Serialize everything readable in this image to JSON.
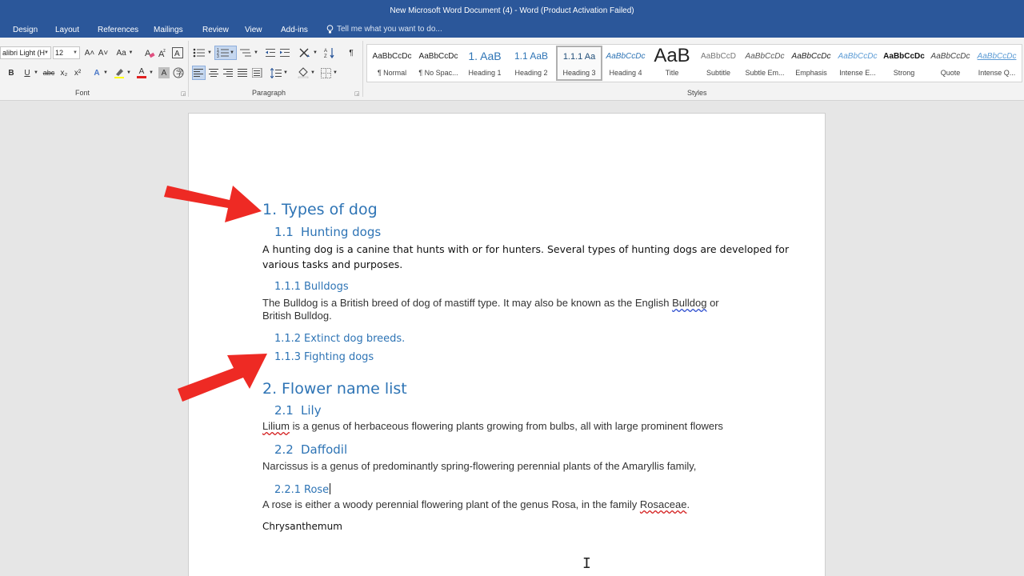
{
  "window": {
    "title": "New Microsoft Word Document (4) - Word (Product Activation Failed)"
  },
  "tabs": [
    "Design",
    "Layout",
    "References",
    "Mailings",
    "Review",
    "View",
    "Add-ins"
  ],
  "tell_me": {
    "placeholder": "Tell me what you want to do..."
  },
  "font_group": {
    "label": "Font",
    "font_name": "alibri Light (H",
    "font_size": "12",
    "case_label": "Aa",
    "bold": "B",
    "italic": "I",
    "underline": "U",
    "strike": "abc",
    "sub": "x₂",
    "sup": "x²",
    "grow": "A˄",
    "shrink": "A˅",
    "font_color": "A",
    "text_effect": "A",
    "char_shade": "A"
  },
  "paragraph_group": {
    "label": "Paragraph",
    "pilcrow": "¶"
  },
  "styles_group": {
    "label": "Styles",
    "items": [
      {
        "preview": "AaBbCcDc",
        "name": "¶ Normal"
      },
      {
        "preview": "AaBbCcDc",
        "name": "¶ No Spac..."
      },
      {
        "preview": "1. AaB",
        "name": "Heading 1"
      },
      {
        "preview": "1.1 AaB",
        "name": "Heading 2"
      },
      {
        "preview": "1.1.1 Aa",
        "name": "Heading 3"
      },
      {
        "preview": "AaBbCcDc",
        "name": "Heading 4"
      },
      {
        "preview": "AaB",
        "name": "Title"
      },
      {
        "preview": "AaBbCcD",
        "name": "Subtitle"
      },
      {
        "preview": "AaBbCcDc",
        "name": "Subtle Em..."
      },
      {
        "preview": "AaBbCcDc",
        "name": "Emphasis"
      },
      {
        "preview": "AaBbCcDc",
        "name": "Intense E..."
      },
      {
        "preview": "AaBbCcDc",
        "name": "Strong"
      },
      {
        "preview": "AaBbCcDc",
        "name": "Quote"
      },
      {
        "preview": "AaBbCcDc",
        "name": "Intense Q..."
      }
    ]
  },
  "document": {
    "h1_1": {
      "num": "1.",
      "text": "Types of dog"
    },
    "h2_1": {
      "num": "1.1",
      "text": "Hunting dogs"
    },
    "p1_line1": "A hunting dog is a canine that hunts with or for hunters. Several types of hunting dogs are developed for",
    "p1_line2": "various tasks and purposes.",
    "h3_1": {
      "num": "1.1.1",
      "text": "Bulldogs"
    },
    "p2_line1_a": "The Bulldog is a British breed of dog of mastiff type. It may also be known as the English ",
    "p2_line1_b": "Bulldog",
    "p2_line1_c": " or",
    "p2_line2": "British Bulldog.",
    "h3_2": {
      "num": "1.1.2",
      "text": "Extinct dog breeds."
    },
    "h3_3": {
      "num": "1.1.3",
      "text": "Fighting dogs"
    },
    "h1_2": {
      "num": "2.",
      "text": "Flower name list"
    },
    "h2_2": {
      "num": "2.1",
      "text": "Lily"
    },
    "p3_a": "Lilium",
    "p3_b": " is a genus of herbaceous flowering plants growing from bulbs, all with large prominent flowers",
    "h2_3": {
      "num": "2.2",
      "text": "Daffodil"
    },
    "p4": "Narcissus is a genus of predominantly spring-flowering perennial plants of the Amaryllis family,",
    "h3_4": {
      "num": "2.2.1",
      "text": "Rose"
    },
    "p5_a": "A rose is either a woody perennial flowering plant of the genus Rosa, in the family ",
    "p5_b": "Rosaceae",
    "p5_c": ".",
    "p6": "Chrysanthemum"
  },
  "colors": {
    "title_bar": "#2b579a",
    "heading": "#2e74b5",
    "arrow": "#ee2a24"
  }
}
